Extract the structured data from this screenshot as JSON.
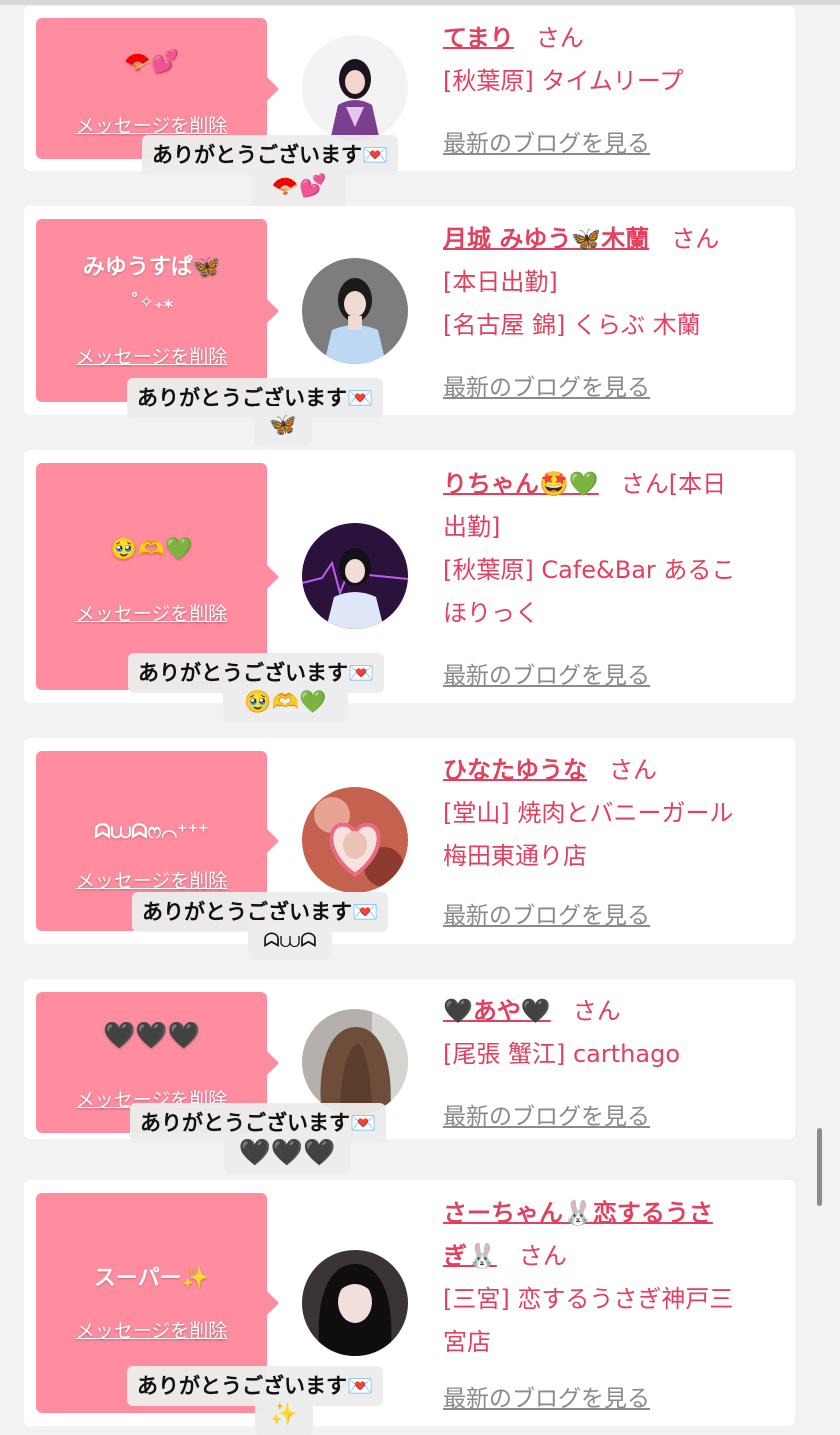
{
  "thanks_text": "ありがとうございます💌",
  "delete_label": "メッセージを削除",
  "blog_label": "最新のブログを見る",
  "san": "さん",
  "cards": [
    {
      "message": "🪭💕",
      "name": "てまり",
      "info_lines": [
        "[秋葉原] タイムリープ"
      ],
      "toast_tail": "🪭💕"
    },
    {
      "message_lines": [
        "みゆうすぱ🦋",
        "˚✧₊⁎"
      ],
      "name": "月城 みゆう🦋木蘭",
      "info_lines": [
        "[本日出勤]",
        "[名古屋 錦] くらぶ 木蘭"
      ],
      "toast_tail": "🦋"
    },
    {
      "message": "🥹🫶💚",
      "name": "りちゃん🤩💚",
      "name_suffix": "[本日",
      "info_lines": [
        "出勤]",
        "[秋葉原] Cafe&Bar あるこ",
        "ほりっく"
      ],
      "toast_tail": "🥹🫶💚"
    },
    {
      "message": "ᗣ⩊ᗣෆ⌒⁺⁺⁺",
      "name": "ひなたゆうな",
      "info_lines": [
        "[堂山] 焼肉とバニーガール",
        "梅田東通り店"
      ],
      "toast_tail": "ᗣ⩊ᗣ"
    },
    {
      "message": "🖤🖤🖤",
      "name": "🖤あや🖤",
      "info_lines": [
        "[尾張 蟹江] carthago"
      ],
      "toast_tail": "🖤🖤🖤"
    },
    {
      "message": "スーパー✨",
      "name_lines": [
        "さーちゃん🐰恋するうさ",
        "ぎ🐰"
      ],
      "info_lines": [
        "[三宮] 恋するうさぎ神戸三",
        "宮店"
      ],
      "toast_tail": "✨"
    }
  ],
  "colors": {
    "page_bg": "#f2f2f2",
    "card_bg": "#ffffff",
    "bubble": "#ff8d9f",
    "accent": "#e1415f",
    "blog_link": "#8a8a8a",
    "toast_bg": "#ececec"
  }
}
